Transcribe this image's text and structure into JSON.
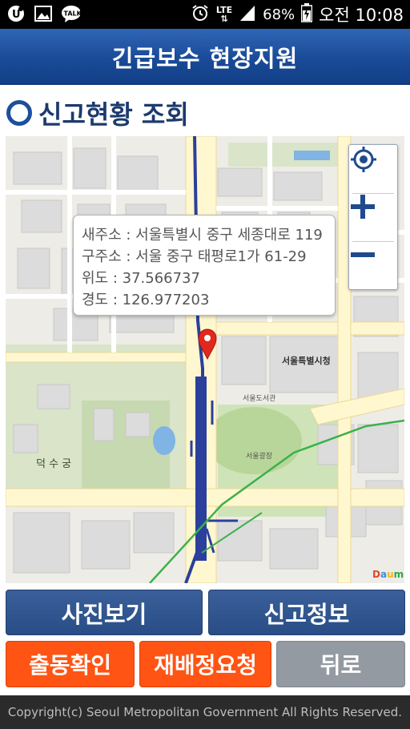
{
  "status_bar": {
    "network_type": "LTE",
    "battery": "68%",
    "time": "오전 10:08",
    "notification_icons": [
      "u-plus-icon",
      "gallery-icon",
      "talk-icon"
    ],
    "talk_label": "TALK"
  },
  "header": {
    "title": "긴급보수 현장지원"
  },
  "section": {
    "title": "신고현황 조회"
  },
  "map": {
    "info": {
      "new_address": "새주소 : 서울특별시 중구 세종대로 119",
      "old_address": "구주소 : 서울 중구 태평로1가 61-29",
      "latitude": "위도 : 37.566737",
      "longitude": "경도 : 126.977203"
    },
    "labels": {
      "city_hall": "서울특별시청",
      "deoksugung": "덕 수 궁",
      "plaza": "서울광장",
      "library": "서울도서관",
      "daum": "Daum"
    },
    "controls": [
      "locate-icon",
      "zoom-in-icon",
      "zoom-out-icon"
    ]
  },
  "buttons": {
    "photos": "사진보기",
    "report_info": "신고정보",
    "dispatch_confirm": "출동확인",
    "reassign_request": "재배정요청",
    "back": "뒤로"
  },
  "colors": {
    "header_blue": "#1a4b98",
    "button_blue": "#2f5590",
    "button_orange": "#ff5414",
    "button_gray": "#949aa2"
  },
  "footer": {
    "copyright": "Copyright(c) Seoul Metropolitan Government All Rights Reserved."
  }
}
